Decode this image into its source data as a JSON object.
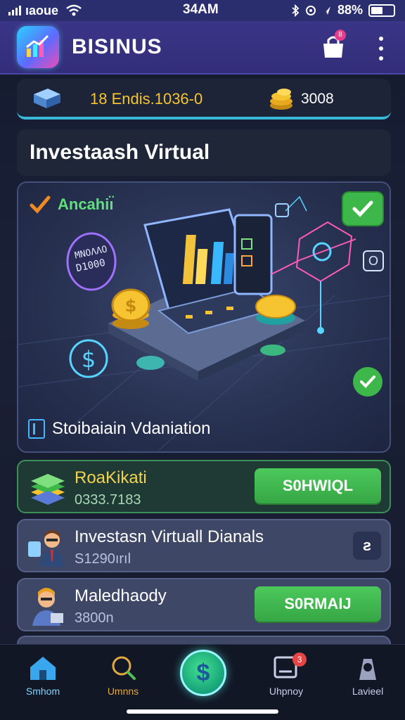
{
  "status_bar": {
    "carrier": "ıaoue",
    "time": "34AM",
    "battery": "88%"
  },
  "header": {
    "title": "BISINUS",
    "badge": "8"
  },
  "balance": {
    "left_text": "18 Endis.1036-0",
    "right_text": "3008"
  },
  "title_card": {
    "title": "Investaash Virtual"
  },
  "hero": {
    "tag_label": "Ancahiı̈",
    "screen_label_1": "ΜΝΟΛΛΟ",
    "screen_label_2": "D1000",
    "info_icon": "O",
    "caption": "Stoibaiain Vdaniation"
  },
  "cards": [
    {
      "title": "RoaKikati",
      "subtitle": "0333.7183",
      "action": "S0HWIQL"
    },
    {
      "title": "Investasn Virtuall Dianals",
      "subtitle": "S1290ırıl",
      "mini": "ƨ"
    },
    {
      "title": "Maledhaody",
      "subtitle": "3800n",
      "action": "S0RMAIJ"
    }
  ],
  "nav": {
    "home": "Smhom",
    "search": "Umnns",
    "history": "Uhpnoy",
    "level": "Lavieel",
    "history_badge": "3"
  },
  "colors": {
    "accent_green": "#3db749",
    "header": "#332e79",
    "gold": "#f5c430"
  }
}
